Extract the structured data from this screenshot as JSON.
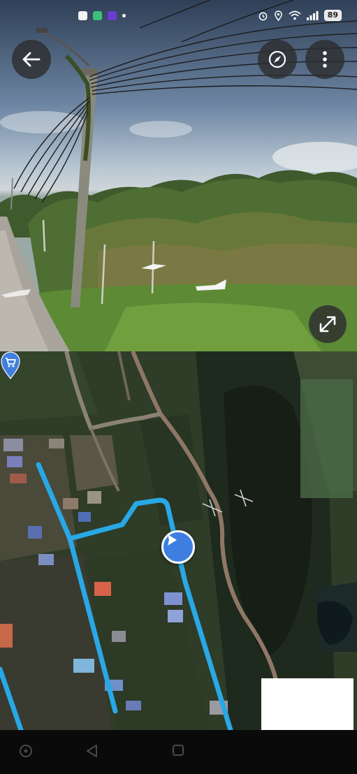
{
  "status_bar": {
    "battery": "89",
    "icons": [
      "app-white-icon",
      "app-green-icon",
      "app-purple-icon",
      "alarm-icon",
      "location-icon",
      "wifi-icon",
      "signal-icon",
      "battery-icon"
    ]
  },
  "street_view": {
    "buttons": [
      "back-arrow-icon",
      "compass-icon",
      "more-vert-icon",
      "expand-icon"
    ]
  },
  "map": {
    "markers": [
      "shopping-cart-pin-icon",
      "navigation-arrow-icon"
    ],
    "route_color": "#29a8e6"
  },
  "nav_bar": {
    "buttons": [
      "home-circle-icon",
      "back-triangle-icon",
      "recents-square-icon"
    ]
  }
}
